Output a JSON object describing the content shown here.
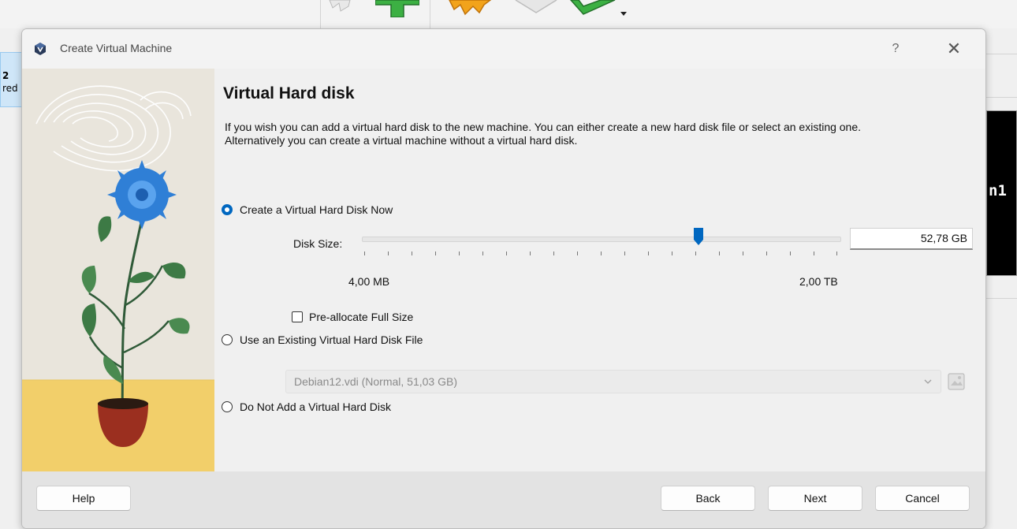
{
  "background": {
    "left_item_lines": [
      "2",
      "red"
    ],
    "preview_text": "n1"
  },
  "dialog": {
    "title": "Create Virtual Machine",
    "help_glyph": "?",
    "close_glyph": "✕",
    "heading": "Virtual Hard disk",
    "description": "If you wish you can add a virtual hard disk to the new machine. You can either create a new hard disk file or select an existing one. Alternatively you can create a virtual machine without a virtual hard disk.",
    "options": {
      "create_now": {
        "label": "Create a Virtual Hard Disk Now",
        "checked": true
      },
      "use_existing": {
        "label": "Use an Existing Virtual Hard Disk File",
        "checked": false
      },
      "do_not_add": {
        "label": "Do Not Add a Virtual Hard Disk",
        "checked": false
      }
    },
    "disk_size": {
      "label": "Disk Size:",
      "value": "52,78 GB",
      "min_label": "4,00 MB",
      "max_label": "2,00 TB",
      "slider_fraction": 0.7
    },
    "preallocate": {
      "label": "Pre-allocate Full Size",
      "checked": false
    },
    "existing_file": {
      "selected": "Debian12.vdi (Normal, 51,03 GB)",
      "enabled": false
    },
    "buttons": {
      "help": "Help",
      "back": "Back",
      "next": "Next",
      "cancel": "Cancel"
    }
  },
  "colors": {
    "accent": "#0067c0",
    "flower_blue": "#2f7fd6",
    "pot": "#9b2f1f",
    "table": "#f2cf6a"
  }
}
